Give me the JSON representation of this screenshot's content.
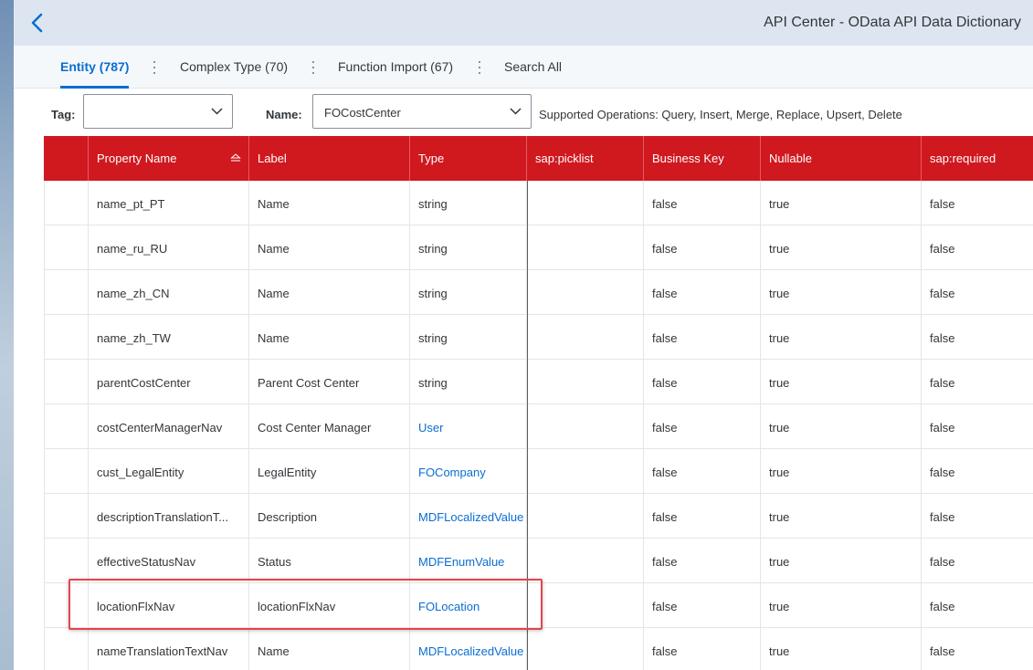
{
  "header": {
    "title": "API Center - OData API Data Dictionary"
  },
  "tabs": [
    {
      "label": "Entity (787)",
      "active": true
    },
    {
      "label": "Complex Type (70)",
      "active": false
    },
    {
      "label": "Function Import (67)",
      "active": false
    },
    {
      "label": "Search All",
      "active": false
    }
  ],
  "filters": {
    "tag_label": "Tag:",
    "tag_value": "",
    "name_label": "Name:",
    "name_value": "FOCostCenter",
    "supported_operations": "Supported Operations: Query, Insert, Merge, Replace, Upsert, Delete"
  },
  "table": {
    "columns": [
      "Property Name",
      "Label",
      "Type",
      "sap:picklist",
      "Business Key",
      "Nullable",
      "sap:required"
    ],
    "sorted_column": "Property Name",
    "sort_direction": "ascending",
    "rows": [
      {
        "property": "name_pt_PT",
        "label": "Name",
        "type": "string",
        "type_link": false,
        "picklist": "",
        "business_key": "false",
        "nullable": "true",
        "required": "false"
      },
      {
        "property": "name_ru_RU",
        "label": "Name",
        "type": "string",
        "type_link": false,
        "picklist": "",
        "business_key": "false",
        "nullable": "true",
        "required": "false"
      },
      {
        "property": "name_zh_CN",
        "label": "Name",
        "type": "string",
        "type_link": false,
        "picklist": "",
        "business_key": "false",
        "nullable": "true",
        "required": "false"
      },
      {
        "property": "name_zh_TW",
        "label": "Name",
        "type": "string",
        "type_link": false,
        "picklist": "",
        "business_key": "false",
        "nullable": "true",
        "required": "false"
      },
      {
        "property": "parentCostCenter",
        "label": "Parent Cost Center",
        "type": "string",
        "type_link": false,
        "picklist": "",
        "business_key": "false",
        "nullable": "true",
        "required": "false"
      },
      {
        "property": "costCenterManagerNav",
        "label": "Cost Center Manager",
        "type": "User",
        "type_link": true,
        "picklist": "",
        "business_key": "false",
        "nullable": "true",
        "required": "false"
      },
      {
        "property": "cust_LegalEntity",
        "label": "LegalEntity",
        "type": "FOCompany",
        "type_link": true,
        "picklist": "",
        "business_key": "false",
        "nullable": "true",
        "required": "false"
      },
      {
        "property": "descriptionTranslationT...",
        "label": "Description",
        "type": "MDFLocalizedValue",
        "type_link": true,
        "picklist": "",
        "business_key": "false",
        "nullable": "true",
        "required": "false"
      },
      {
        "property": "effectiveStatusNav",
        "label": "Status",
        "type": "MDFEnumValue",
        "type_link": true,
        "picklist": "",
        "business_key": "false",
        "nullable": "true",
        "required": "false"
      },
      {
        "property": "locationFlxNav",
        "label": "locationFlxNav",
        "type": "FOLocation",
        "type_link": true,
        "picklist": "",
        "business_key": "false",
        "nullable": "true",
        "required": "false"
      },
      {
        "property": "nameTranslationTextNav",
        "label": "Name",
        "type": "MDFLocalizedValue",
        "type_link": true,
        "picklist": "",
        "business_key": "false",
        "nullable": "true",
        "required": "false"
      }
    ]
  },
  "highlighted_row_property": "locationFlxNav",
  "colors": {
    "header_bg": "#dde6f0",
    "table_header_bg": "#d0181f",
    "link": "#0a6ed1",
    "highlight_border": "#e5444b"
  }
}
